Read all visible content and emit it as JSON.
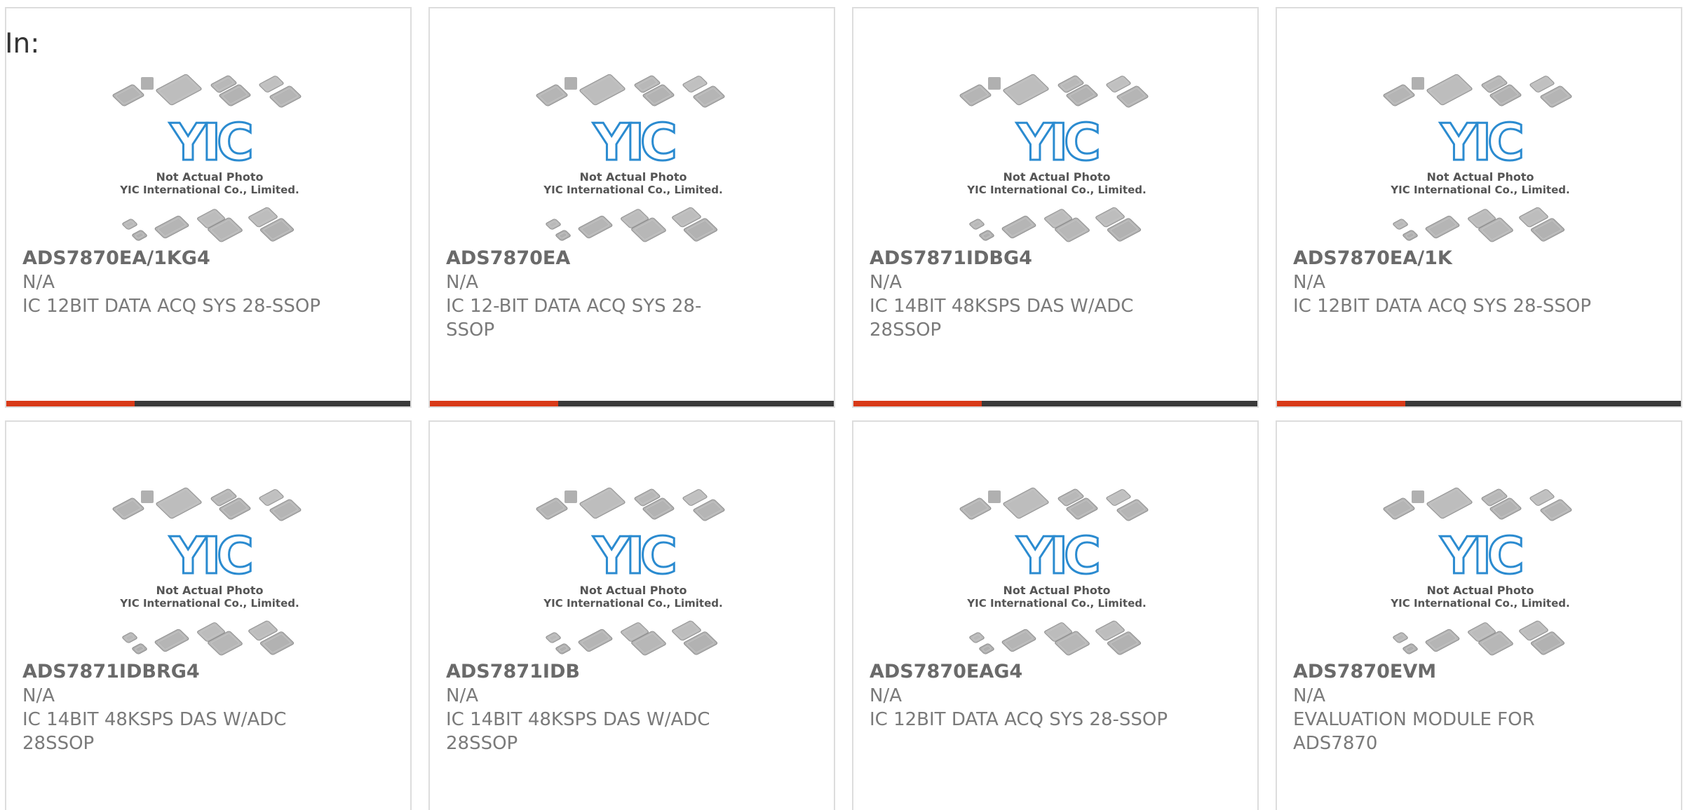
{
  "in_label": "In:",
  "photo": {
    "logo_text": "YIC",
    "caption_line1": "Not Actual Photo",
    "caption_line2": "YIC International Co., Limited.",
    "logo_color": "#2b8bd0",
    "chip_color": "#a8a8a8"
  },
  "colors": {
    "accent_bar": "#d83a18",
    "bar": "#3a3a3a",
    "border": "#dddddd",
    "text": "#7a7a7a"
  },
  "products": [
    {
      "part": "ADS7870EA/1KG4",
      "mfr": "N/A",
      "desc": "IC 12BIT DATA ACQ SYS 28-SSOP"
    },
    {
      "part": "ADS7870EA",
      "mfr": "N/A",
      "desc": "IC 12-BIT DATA ACQ SYS 28-SSOP"
    },
    {
      "part": "ADS7871IDBG4",
      "mfr": "N/A",
      "desc": "IC 14BIT 48KSPS DAS W/ADC 28SSOP"
    },
    {
      "part": "ADS7870EA/1K",
      "mfr": "N/A",
      "desc": "IC 12BIT DATA ACQ SYS 28-SSOP"
    },
    {
      "part": "ADS7871IDBRG4",
      "mfr": "N/A",
      "desc": "IC 14BIT 48KSPS DAS W/ADC 28SSOP"
    },
    {
      "part": "ADS7871IDB",
      "mfr": "N/A",
      "desc": "IC 14BIT 48KSPS DAS W/ADC 28SSOP"
    },
    {
      "part": "ADS7870EAG4",
      "mfr": "N/A",
      "desc": "IC 12BIT DATA ACQ SYS 28-SSOP"
    },
    {
      "part": "ADS7870EVM",
      "mfr": "N/A",
      "desc": "EVALUATION MODULE FOR ADS7870"
    }
  ]
}
